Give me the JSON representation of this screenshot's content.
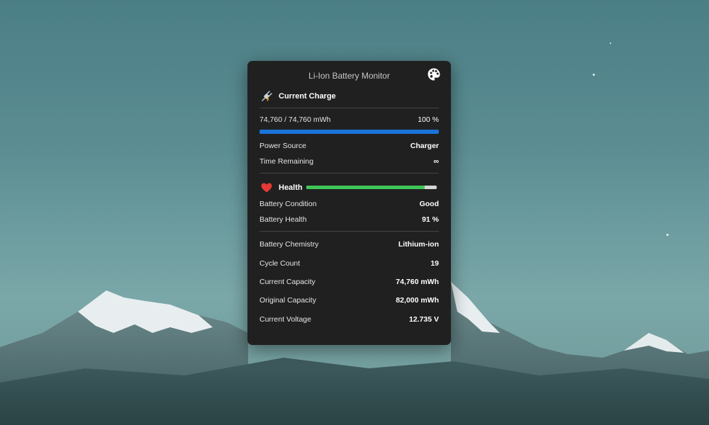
{
  "window": {
    "title": "Li-Ion Battery Monitor"
  },
  "icons": {
    "theme": "palette-icon",
    "charge": "plug-charging-icon",
    "health": "heart-icon"
  },
  "charge": {
    "heading": "Current Charge",
    "energy_text": "74,760 / 74,760 mWh",
    "percent_text": "100 %",
    "percent_value": 100,
    "bar_color": "#1a73d9",
    "power_source_label": "Power Source",
    "power_source_value": "Charger",
    "time_remaining_label": "Time Remaining",
    "time_remaining_value": "∞"
  },
  "health": {
    "heading": "Health",
    "percent_value": 91,
    "bar_color": "#3fc65a",
    "heart_color": "#e53935",
    "condition_label": "Battery Condition",
    "condition_value": "Good",
    "health_label": "Battery Health",
    "health_value": "91 %"
  },
  "details": [
    {
      "label": "Battery Chemistry",
      "value": "Lithium-ion"
    },
    {
      "label": "Cycle Count",
      "value": "19"
    },
    {
      "label": "Current Capacity",
      "value": "74,760 mWh"
    },
    {
      "label": "Original Capacity",
      "value": "82,000 mWh"
    },
    {
      "label": "Current Voltage",
      "value": "12.735 V"
    }
  ]
}
